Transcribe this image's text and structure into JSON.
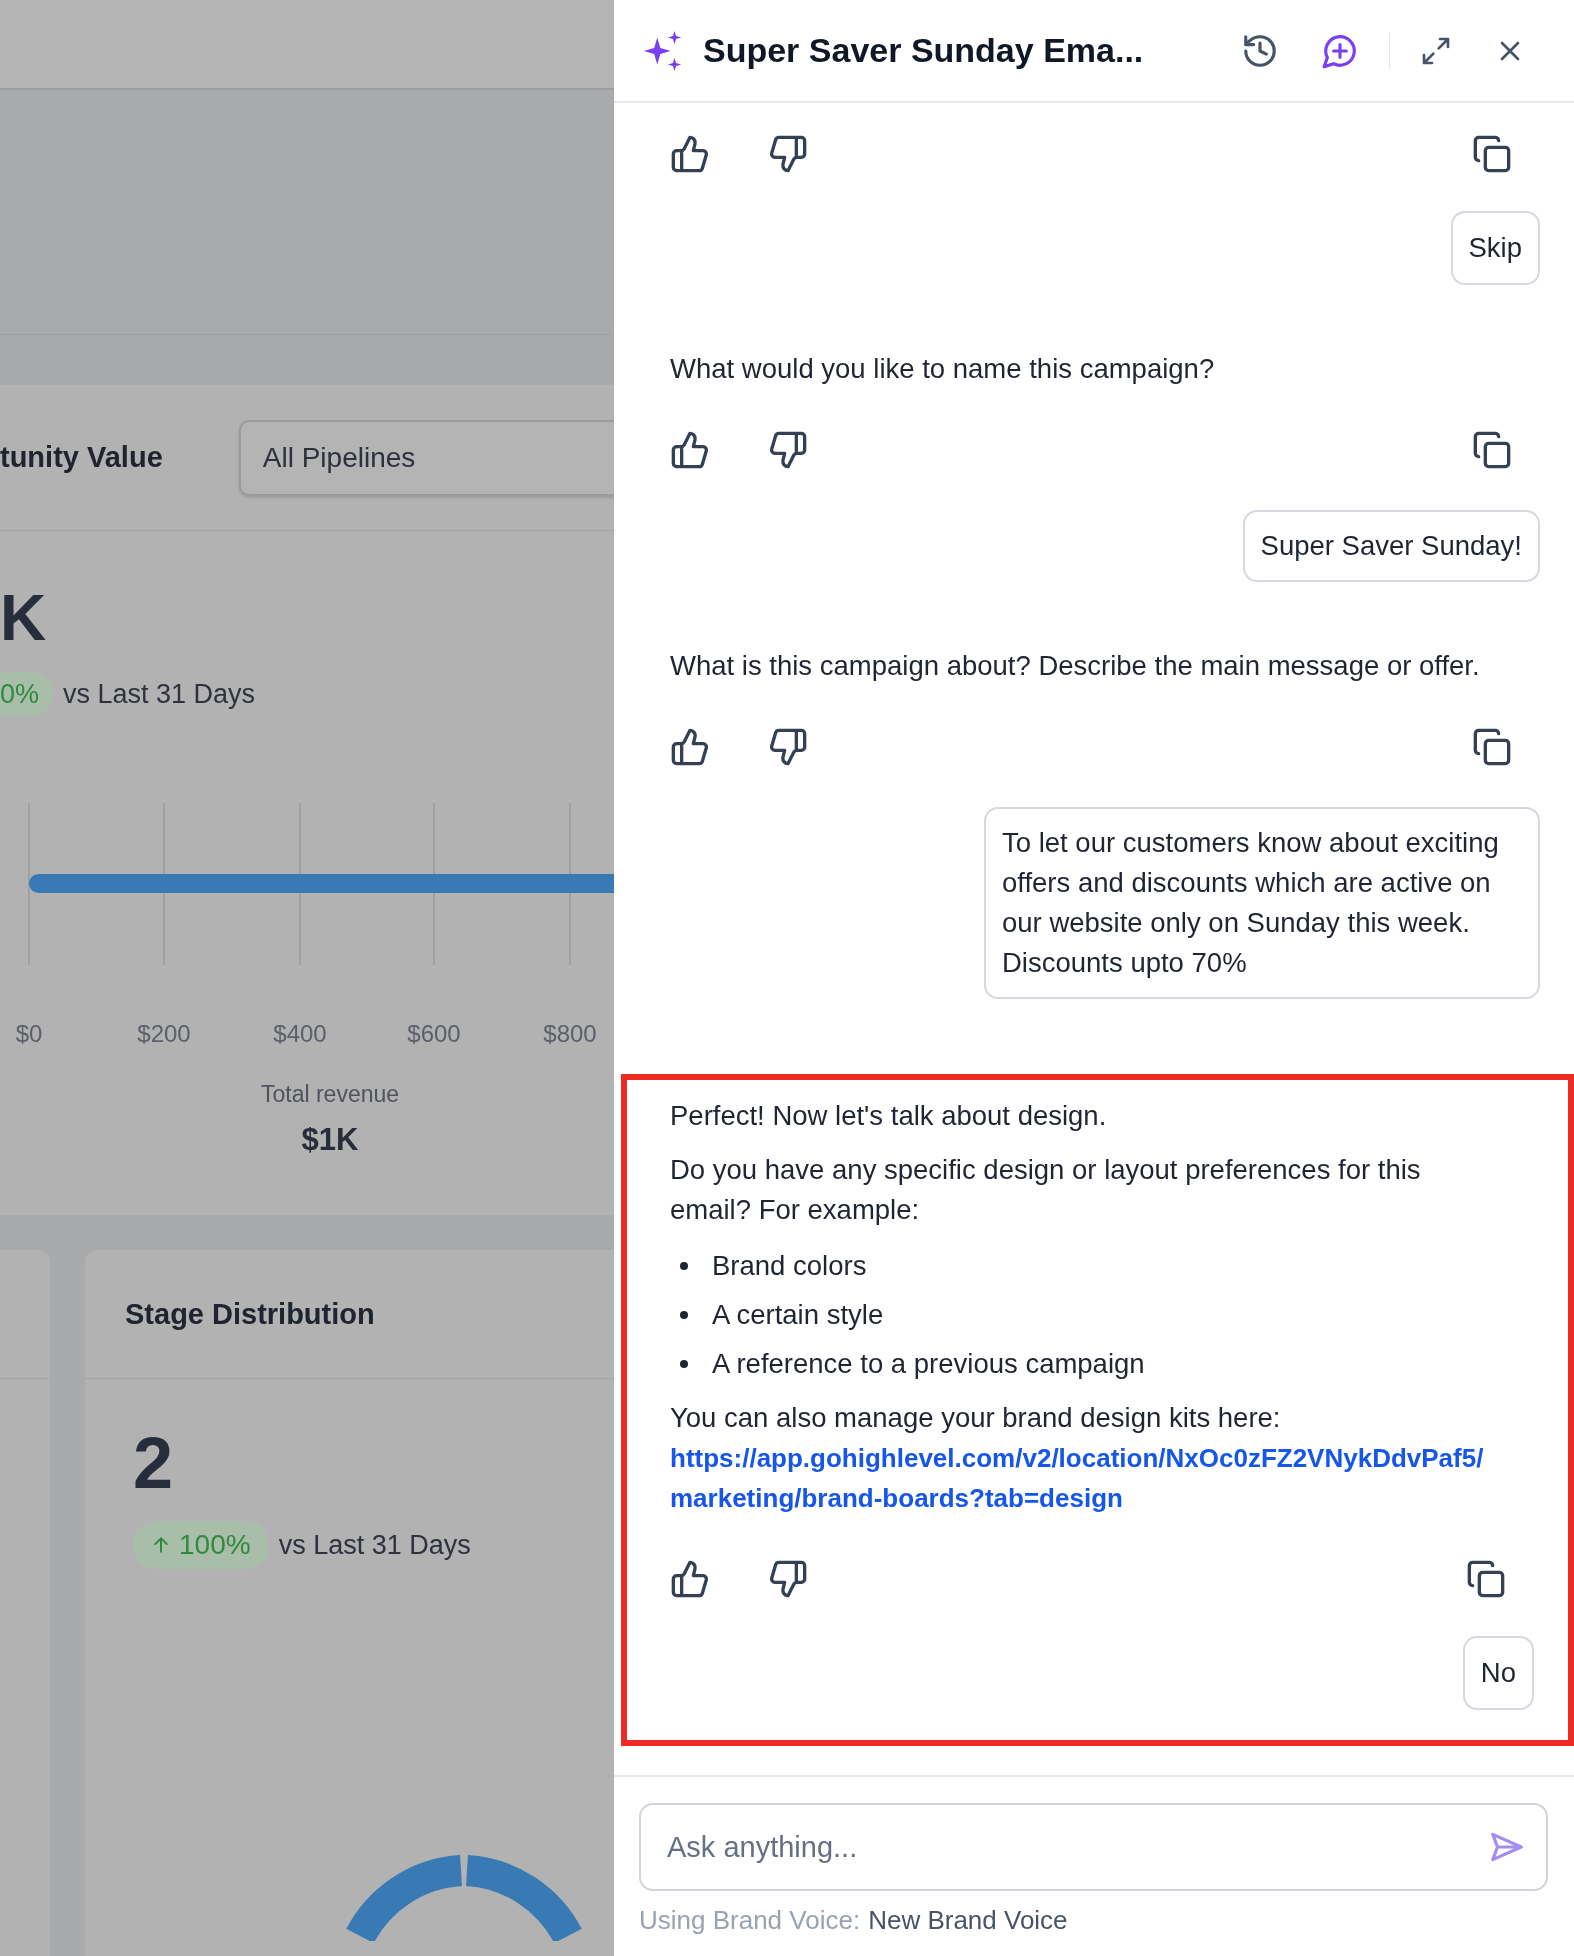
{
  "dashboard": {
    "revenue_card": {
      "title": "tunity Value",
      "pipeline_select": "All Pipelines",
      "metric": "K",
      "change": "0%",
      "comparison": "vs Last 31 Days",
      "axis_labels": [
        "$0",
        "$200",
        "$400",
        "$600",
        "$800"
      ],
      "total_label": "Total revenue",
      "total_value": "$1K"
    },
    "stage_card": {
      "title": "Stage Distribution",
      "metric": "2",
      "change": "100%",
      "comparison": "vs Last 31 Days"
    }
  },
  "assistant": {
    "title": "Super Saver Sunday Ema...",
    "messages": [
      {
        "kind": "bot",
        "highlighted": false
      },
      {
        "kind": "quick_reply",
        "text": "Skip",
        "highlighted": false
      },
      {
        "kind": "bot",
        "highlighted": false,
        "blocks": [
          {
            "kind": "paragraph",
            "text": "What would you like to name this campaign?"
          }
        ]
      },
      {
        "kind": "user",
        "text": "Super Saver Sunday!",
        "highlighted": false
      },
      {
        "kind": "bot",
        "highlighted": false,
        "blocks": [
          {
            "kind": "paragraph",
            "text": "What is this campaign about? Describe the main message or offer."
          }
        ]
      },
      {
        "kind": "user",
        "text": "To let our customers know about exciting offers and discounts which are active on our website only on Sunday this week. Discounts upto 70%",
        "highlighted": false
      },
      {
        "kind": "bot",
        "highlighted": true,
        "blocks": [
          {
            "kind": "paragraph",
            "text": "Perfect! Now let's talk about design."
          },
          {
            "kind": "paragraph",
            "text": "Do you have any specific design or layout preferences for this email? For example:"
          },
          {
            "kind": "bullets",
            "items": [
              "Brand colors",
              "A certain style",
              "A reference to a previous campaign"
            ]
          },
          {
            "kind": "paragraph",
            "text": "You can also manage your brand design kits here:"
          },
          {
            "kind": "link",
            "text": "https://app.gohighlevel.com/v2/location/NxOc0zFZ2VNykDdvPaf5/marketing/brand-boards?tab=design"
          }
        ]
      },
      {
        "kind": "quick_reply",
        "text": "No",
        "highlighted": true
      }
    ],
    "input": {
      "placeholder": "Ask anything..."
    },
    "brand_voice": {
      "label": "Using Brand Voice:",
      "value": "New Brand Voice"
    }
  }
}
